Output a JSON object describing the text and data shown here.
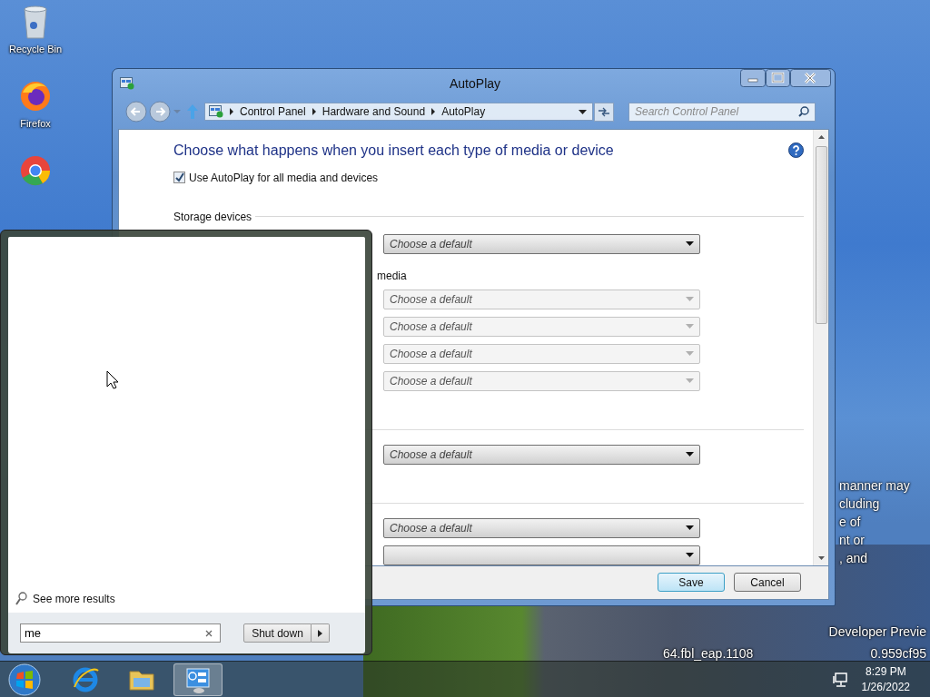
{
  "desktop": {
    "icons": [
      {
        "kind": "recycle",
        "label": "Recycle Bin"
      },
      {
        "kind": "firefox",
        "label": "Firefox"
      },
      {
        "kind": "chrome"
      }
    ],
    "watermark_lines": [
      "manner may",
      "cluding",
      "e of",
      "nt or",
      ", and"
    ],
    "build_lines": [
      "Developer Previe",
      "64.fbl_eap.1108",
      "0.959cf95"
    ]
  },
  "window": {
    "title": "AutoPlay",
    "address": {
      "path": [
        "Control Panel",
        "Hardware and Sound",
        "AutoPlay"
      ]
    },
    "search": {
      "placeholder": "Search Control Panel"
    },
    "heading": "Choose what happens when you insert each type of media or device",
    "checkbox": {
      "label": "Use AutoPlay for all media and devices",
      "checked": true
    },
    "items": [
      {
        "kind": "section",
        "title": "Storage devices"
      },
      {
        "kind": "dropdown",
        "value": "Choose a default",
        "disabled": false
      },
      {
        "kind": "label",
        "text": "media"
      },
      {
        "kind": "dropdown",
        "value": "Choose a default",
        "disabled": true
      },
      {
        "kind": "dropdown",
        "value": "Choose a default",
        "disabled": true
      },
      {
        "kind": "dropdown",
        "value": "Choose a default",
        "disabled": true
      },
      {
        "kind": "dropdown",
        "value": "Choose a default",
        "disabled": true
      },
      {
        "kind": "separator"
      },
      {
        "kind": "dropdown",
        "value": "Choose a default",
        "disabled": false
      },
      {
        "kind": "separator"
      },
      {
        "kind": "dropdown",
        "value": "Choose a default",
        "disabled": false
      },
      {
        "kind": "dropdown",
        "disabled": false
      }
    ],
    "buttons": [
      {
        "label": "Save",
        "default": true
      },
      {
        "label": "Cancel",
        "default": false
      }
    ]
  },
  "start_menu": {
    "more_results": "See more results",
    "search": {
      "value": "me"
    },
    "shutdown": "Shut down"
  },
  "taskbar": {
    "apps": [
      {
        "kind": "ie",
        "selected": false
      },
      {
        "kind": "explorer",
        "selected": false
      },
      {
        "kind": "control",
        "selected": true
      }
    ],
    "clock": {
      "time": "8:29 PM",
      "date": "1/26/2022"
    }
  }
}
